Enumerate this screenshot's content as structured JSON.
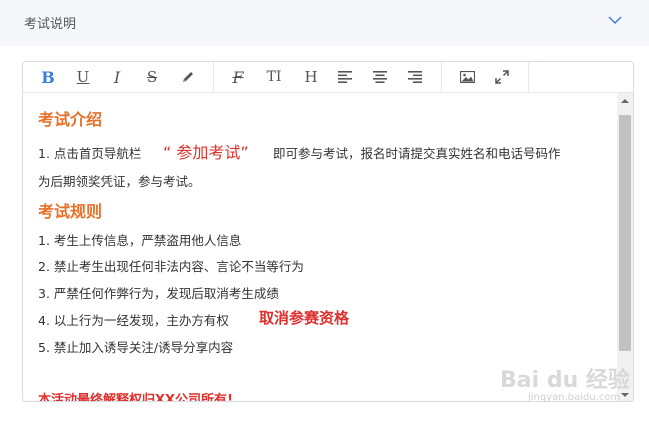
{
  "section": {
    "title": "考试说明"
  },
  "toolbar": {
    "buttons": [
      {
        "id": "bold",
        "icon": "bold-icon",
        "glyph": "B"
      },
      {
        "id": "underline",
        "icon": "underline-icon",
        "glyph": "U"
      },
      {
        "id": "italic",
        "icon": "italic-icon",
        "glyph": "I"
      },
      {
        "id": "strikethrough",
        "icon": "strikethrough-icon",
        "glyph": "S"
      },
      {
        "id": "highlight",
        "icon": "pencil-icon",
        "glyph": ""
      },
      {
        "id": "clear-format",
        "icon": "clear-format-icon",
        "glyph": "F"
      },
      {
        "id": "font-size",
        "icon": "font-size-icon",
        "glyph": "TI"
      },
      {
        "id": "heading",
        "icon": "heading-icon",
        "glyph": "H"
      },
      {
        "id": "align-left",
        "icon": "align-left-icon",
        "glyph": ""
      },
      {
        "id": "align-center",
        "icon": "align-center-icon",
        "glyph": ""
      },
      {
        "id": "align-right",
        "icon": "align-right-icon",
        "glyph": ""
      },
      {
        "id": "image",
        "icon": "image-icon",
        "glyph": ""
      },
      {
        "id": "fullscreen",
        "icon": "fullscreen-icon",
        "glyph": ""
      }
    ],
    "active_color": "#3b7ddd"
  },
  "content": {
    "intro_heading": "考试介绍",
    "intro_line1_a": "1. 点击首页导航栏",
    "intro_line1_highlight": "“ 参加考试”",
    "intro_line1_b": "即可参与考试，报名时请提交真实姓名和电话号码作",
    "intro_line2": "为后期领奖凭证，参与考试。",
    "rules_heading": "考试规则",
    "rules": [
      "1. 考生上传信息，严禁盗用他人信息",
      "2. 禁止考生出现任何非法内容、言论不当等行为",
      "3. 严禁任何作弊行为，发现后取消考生成绩",
      "4. 以上行为一经发现，主办方有权",
      "5. 禁止加入诱导关注/诱导分享内容"
    ],
    "rule4_highlight": "取消参赛资格",
    "footer": "本活动最终解释权归XX公司所有!"
  },
  "watermark": {
    "main": "Bai du 经验",
    "sub": "jingyan.baidu.com"
  },
  "colors": {
    "heading": "#e8702a",
    "highlight": "#e0302d"
  }
}
